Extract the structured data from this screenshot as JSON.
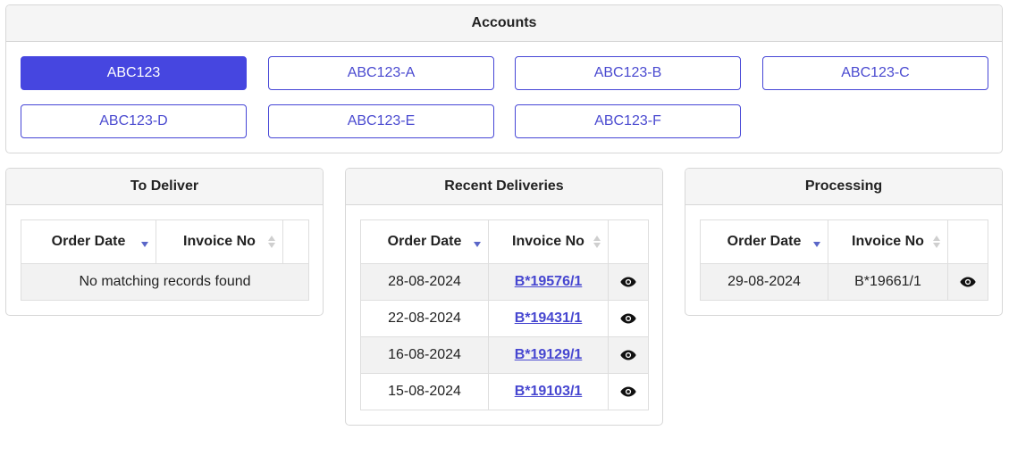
{
  "accounts": {
    "title": "Accounts",
    "buttons": [
      "ABC123",
      "ABC123-A",
      "ABC123-B",
      "ABC123-C",
      "ABC123-D",
      "ABC123-E",
      "ABC123-F"
    ],
    "active": "ABC123"
  },
  "to_deliver": {
    "title": "To Deliver",
    "columns": [
      "Order Date",
      "Invoice No"
    ],
    "empty_message": "No matching records found"
  },
  "recent_deliveries": {
    "title": "Recent Deliveries",
    "columns": [
      "Order Date",
      "Invoice No"
    ],
    "rows": [
      {
        "date": "28-08-2024",
        "invoice": "B*19576/1"
      },
      {
        "date": "22-08-2024",
        "invoice": "B*19431/1"
      },
      {
        "date": "16-08-2024",
        "invoice": "B*19129/1"
      },
      {
        "date": "15-08-2024",
        "invoice": "B*19103/1"
      }
    ]
  },
  "processing": {
    "title": "Processing",
    "columns": [
      "Order Date",
      "Invoice No"
    ],
    "rows": [
      {
        "date": "29-08-2024",
        "invoice": "B*19661/1"
      }
    ]
  },
  "icons": {
    "view": "eye-icon",
    "sort_desc": "sort-desc-icon",
    "sort_both": "sort-both-icon"
  },
  "colors": {
    "accent": "#4646e0",
    "link": "#4646d0",
    "header_bg": "#f5f5f5"
  }
}
